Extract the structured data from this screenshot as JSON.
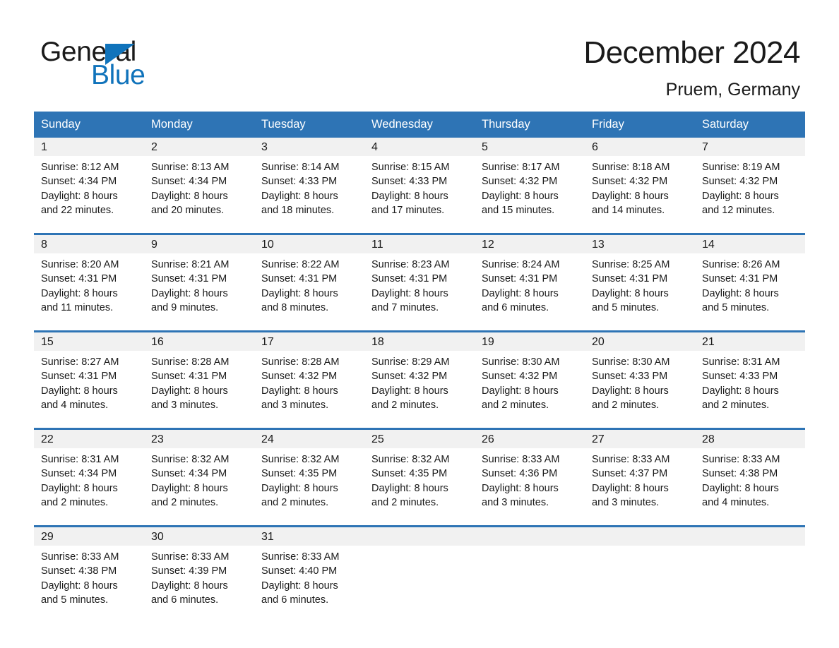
{
  "brand": {
    "name_part1": "General",
    "name_part2": "Blue",
    "logo_icon": "triangle-logo-icon",
    "accent_color": "#1073bb"
  },
  "header": {
    "month_title": "December 2024",
    "location": "Pruem, Germany"
  },
  "theme": {
    "header_blue": "#2e74b5",
    "row_separator": "#2e74b5",
    "daynum_band": "#f1f1f1",
    "text": "#1a1a1a"
  },
  "weekday_headers": [
    "Sunday",
    "Monday",
    "Tuesday",
    "Wednesday",
    "Thursday",
    "Friday",
    "Saturday"
  ],
  "weeks": [
    {
      "days": [
        {
          "date": "1",
          "sunrise": "Sunrise: 8:12 AM",
          "sunset": "Sunset: 4:34 PM",
          "daylight_line1": "Daylight: 8 hours",
          "daylight_line2": "and 22 minutes."
        },
        {
          "date": "2",
          "sunrise": "Sunrise: 8:13 AM",
          "sunset": "Sunset: 4:34 PM",
          "daylight_line1": "Daylight: 8 hours",
          "daylight_line2": "and 20 minutes."
        },
        {
          "date": "3",
          "sunrise": "Sunrise: 8:14 AM",
          "sunset": "Sunset: 4:33 PM",
          "daylight_line1": "Daylight: 8 hours",
          "daylight_line2": "and 18 minutes."
        },
        {
          "date": "4",
          "sunrise": "Sunrise: 8:15 AM",
          "sunset": "Sunset: 4:33 PM",
          "daylight_line1": "Daylight: 8 hours",
          "daylight_line2": "and 17 minutes."
        },
        {
          "date": "5",
          "sunrise": "Sunrise: 8:17 AM",
          "sunset": "Sunset: 4:32 PM",
          "daylight_line1": "Daylight: 8 hours",
          "daylight_line2": "and 15 minutes."
        },
        {
          "date": "6",
          "sunrise": "Sunrise: 8:18 AM",
          "sunset": "Sunset: 4:32 PM",
          "daylight_line1": "Daylight: 8 hours",
          "daylight_line2": "and 14 minutes."
        },
        {
          "date": "7",
          "sunrise": "Sunrise: 8:19 AM",
          "sunset": "Sunset: 4:32 PM",
          "daylight_line1": "Daylight: 8 hours",
          "daylight_line2": "and 12 minutes."
        }
      ]
    },
    {
      "days": [
        {
          "date": "8",
          "sunrise": "Sunrise: 8:20 AM",
          "sunset": "Sunset: 4:31 PM",
          "daylight_line1": "Daylight: 8 hours",
          "daylight_line2": "and 11 minutes."
        },
        {
          "date": "9",
          "sunrise": "Sunrise: 8:21 AM",
          "sunset": "Sunset: 4:31 PM",
          "daylight_line1": "Daylight: 8 hours",
          "daylight_line2": "and 9 minutes."
        },
        {
          "date": "10",
          "sunrise": "Sunrise: 8:22 AM",
          "sunset": "Sunset: 4:31 PM",
          "daylight_line1": "Daylight: 8 hours",
          "daylight_line2": "and 8 minutes."
        },
        {
          "date": "11",
          "sunrise": "Sunrise: 8:23 AM",
          "sunset": "Sunset: 4:31 PM",
          "daylight_line1": "Daylight: 8 hours",
          "daylight_line2": "and 7 minutes."
        },
        {
          "date": "12",
          "sunrise": "Sunrise: 8:24 AM",
          "sunset": "Sunset: 4:31 PM",
          "daylight_line1": "Daylight: 8 hours",
          "daylight_line2": "and 6 minutes."
        },
        {
          "date": "13",
          "sunrise": "Sunrise: 8:25 AM",
          "sunset": "Sunset: 4:31 PM",
          "daylight_line1": "Daylight: 8 hours",
          "daylight_line2": "and 5 minutes."
        },
        {
          "date": "14",
          "sunrise": "Sunrise: 8:26 AM",
          "sunset": "Sunset: 4:31 PM",
          "daylight_line1": "Daylight: 8 hours",
          "daylight_line2": "and 5 minutes."
        }
      ]
    },
    {
      "days": [
        {
          "date": "15",
          "sunrise": "Sunrise: 8:27 AM",
          "sunset": "Sunset: 4:31 PM",
          "daylight_line1": "Daylight: 8 hours",
          "daylight_line2": "and 4 minutes."
        },
        {
          "date": "16",
          "sunrise": "Sunrise: 8:28 AM",
          "sunset": "Sunset: 4:31 PM",
          "daylight_line1": "Daylight: 8 hours",
          "daylight_line2": "and 3 minutes."
        },
        {
          "date": "17",
          "sunrise": "Sunrise: 8:28 AM",
          "sunset": "Sunset: 4:32 PM",
          "daylight_line1": "Daylight: 8 hours",
          "daylight_line2": "and 3 minutes."
        },
        {
          "date": "18",
          "sunrise": "Sunrise: 8:29 AM",
          "sunset": "Sunset: 4:32 PM",
          "daylight_line1": "Daylight: 8 hours",
          "daylight_line2": "and 2 minutes."
        },
        {
          "date": "19",
          "sunrise": "Sunrise: 8:30 AM",
          "sunset": "Sunset: 4:32 PM",
          "daylight_line1": "Daylight: 8 hours",
          "daylight_line2": "and 2 minutes."
        },
        {
          "date": "20",
          "sunrise": "Sunrise: 8:30 AM",
          "sunset": "Sunset: 4:33 PM",
          "daylight_line1": "Daylight: 8 hours",
          "daylight_line2": "and 2 minutes."
        },
        {
          "date": "21",
          "sunrise": "Sunrise: 8:31 AM",
          "sunset": "Sunset: 4:33 PM",
          "daylight_line1": "Daylight: 8 hours",
          "daylight_line2": "and 2 minutes."
        }
      ]
    },
    {
      "days": [
        {
          "date": "22",
          "sunrise": "Sunrise: 8:31 AM",
          "sunset": "Sunset: 4:34 PM",
          "daylight_line1": "Daylight: 8 hours",
          "daylight_line2": "and 2 minutes."
        },
        {
          "date": "23",
          "sunrise": "Sunrise: 8:32 AM",
          "sunset": "Sunset: 4:34 PM",
          "daylight_line1": "Daylight: 8 hours",
          "daylight_line2": "and 2 minutes."
        },
        {
          "date": "24",
          "sunrise": "Sunrise: 8:32 AM",
          "sunset": "Sunset: 4:35 PM",
          "daylight_line1": "Daylight: 8 hours",
          "daylight_line2": "and 2 minutes."
        },
        {
          "date": "25",
          "sunrise": "Sunrise: 8:32 AM",
          "sunset": "Sunset: 4:35 PM",
          "daylight_line1": "Daylight: 8 hours",
          "daylight_line2": "and 2 minutes."
        },
        {
          "date": "26",
          "sunrise": "Sunrise: 8:33 AM",
          "sunset": "Sunset: 4:36 PM",
          "daylight_line1": "Daylight: 8 hours",
          "daylight_line2": "and 3 minutes."
        },
        {
          "date": "27",
          "sunrise": "Sunrise: 8:33 AM",
          "sunset": "Sunset: 4:37 PM",
          "daylight_line1": "Daylight: 8 hours",
          "daylight_line2": "and 3 minutes."
        },
        {
          "date": "28",
          "sunrise": "Sunrise: 8:33 AM",
          "sunset": "Sunset: 4:38 PM",
          "daylight_line1": "Daylight: 8 hours",
          "daylight_line2": "and 4 minutes."
        }
      ]
    },
    {
      "days": [
        {
          "date": "29",
          "sunrise": "Sunrise: 8:33 AM",
          "sunset": "Sunset: 4:38 PM",
          "daylight_line1": "Daylight: 8 hours",
          "daylight_line2": "and 5 minutes."
        },
        {
          "date": "30",
          "sunrise": "Sunrise: 8:33 AM",
          "sunset": "Sunset: 4:39 PM",
          "daylight_line1": "Daylight: 8 hours",
          "daylight_line2": "and 6 minutes."
        },
        {
          "date": "31",
          "sunrise": "Sunrise: 8:33 AM",
          "sunset": "Sunset: 4:40 PM",
          "daylight_line1": "Daylight: 8 hours",
          "daylight_line2": "and 6 minutes."
        },
        {
          "date": "",
          "sunrise": "",
          "sunset": "",
          "daylight_line1": "",
          "daylight_line2": ""
        },
        {
          "date": "",
          "sunrise": "",
          "sunset": "",
          "daylight_line1": "",
          "daylight_line2": ""
        },
        {
          "date": "",
          "sunrise": "",
          "sunset": "",
          "daylight_line1": "",
          "daylight_line2": ""
        },
        {
          "date": "",
          "sunrise": "",
          "sunset": "",
          "daylight_line1": "",
          "daylight_line2": ""
        }
      ]
    }
  ]
}
